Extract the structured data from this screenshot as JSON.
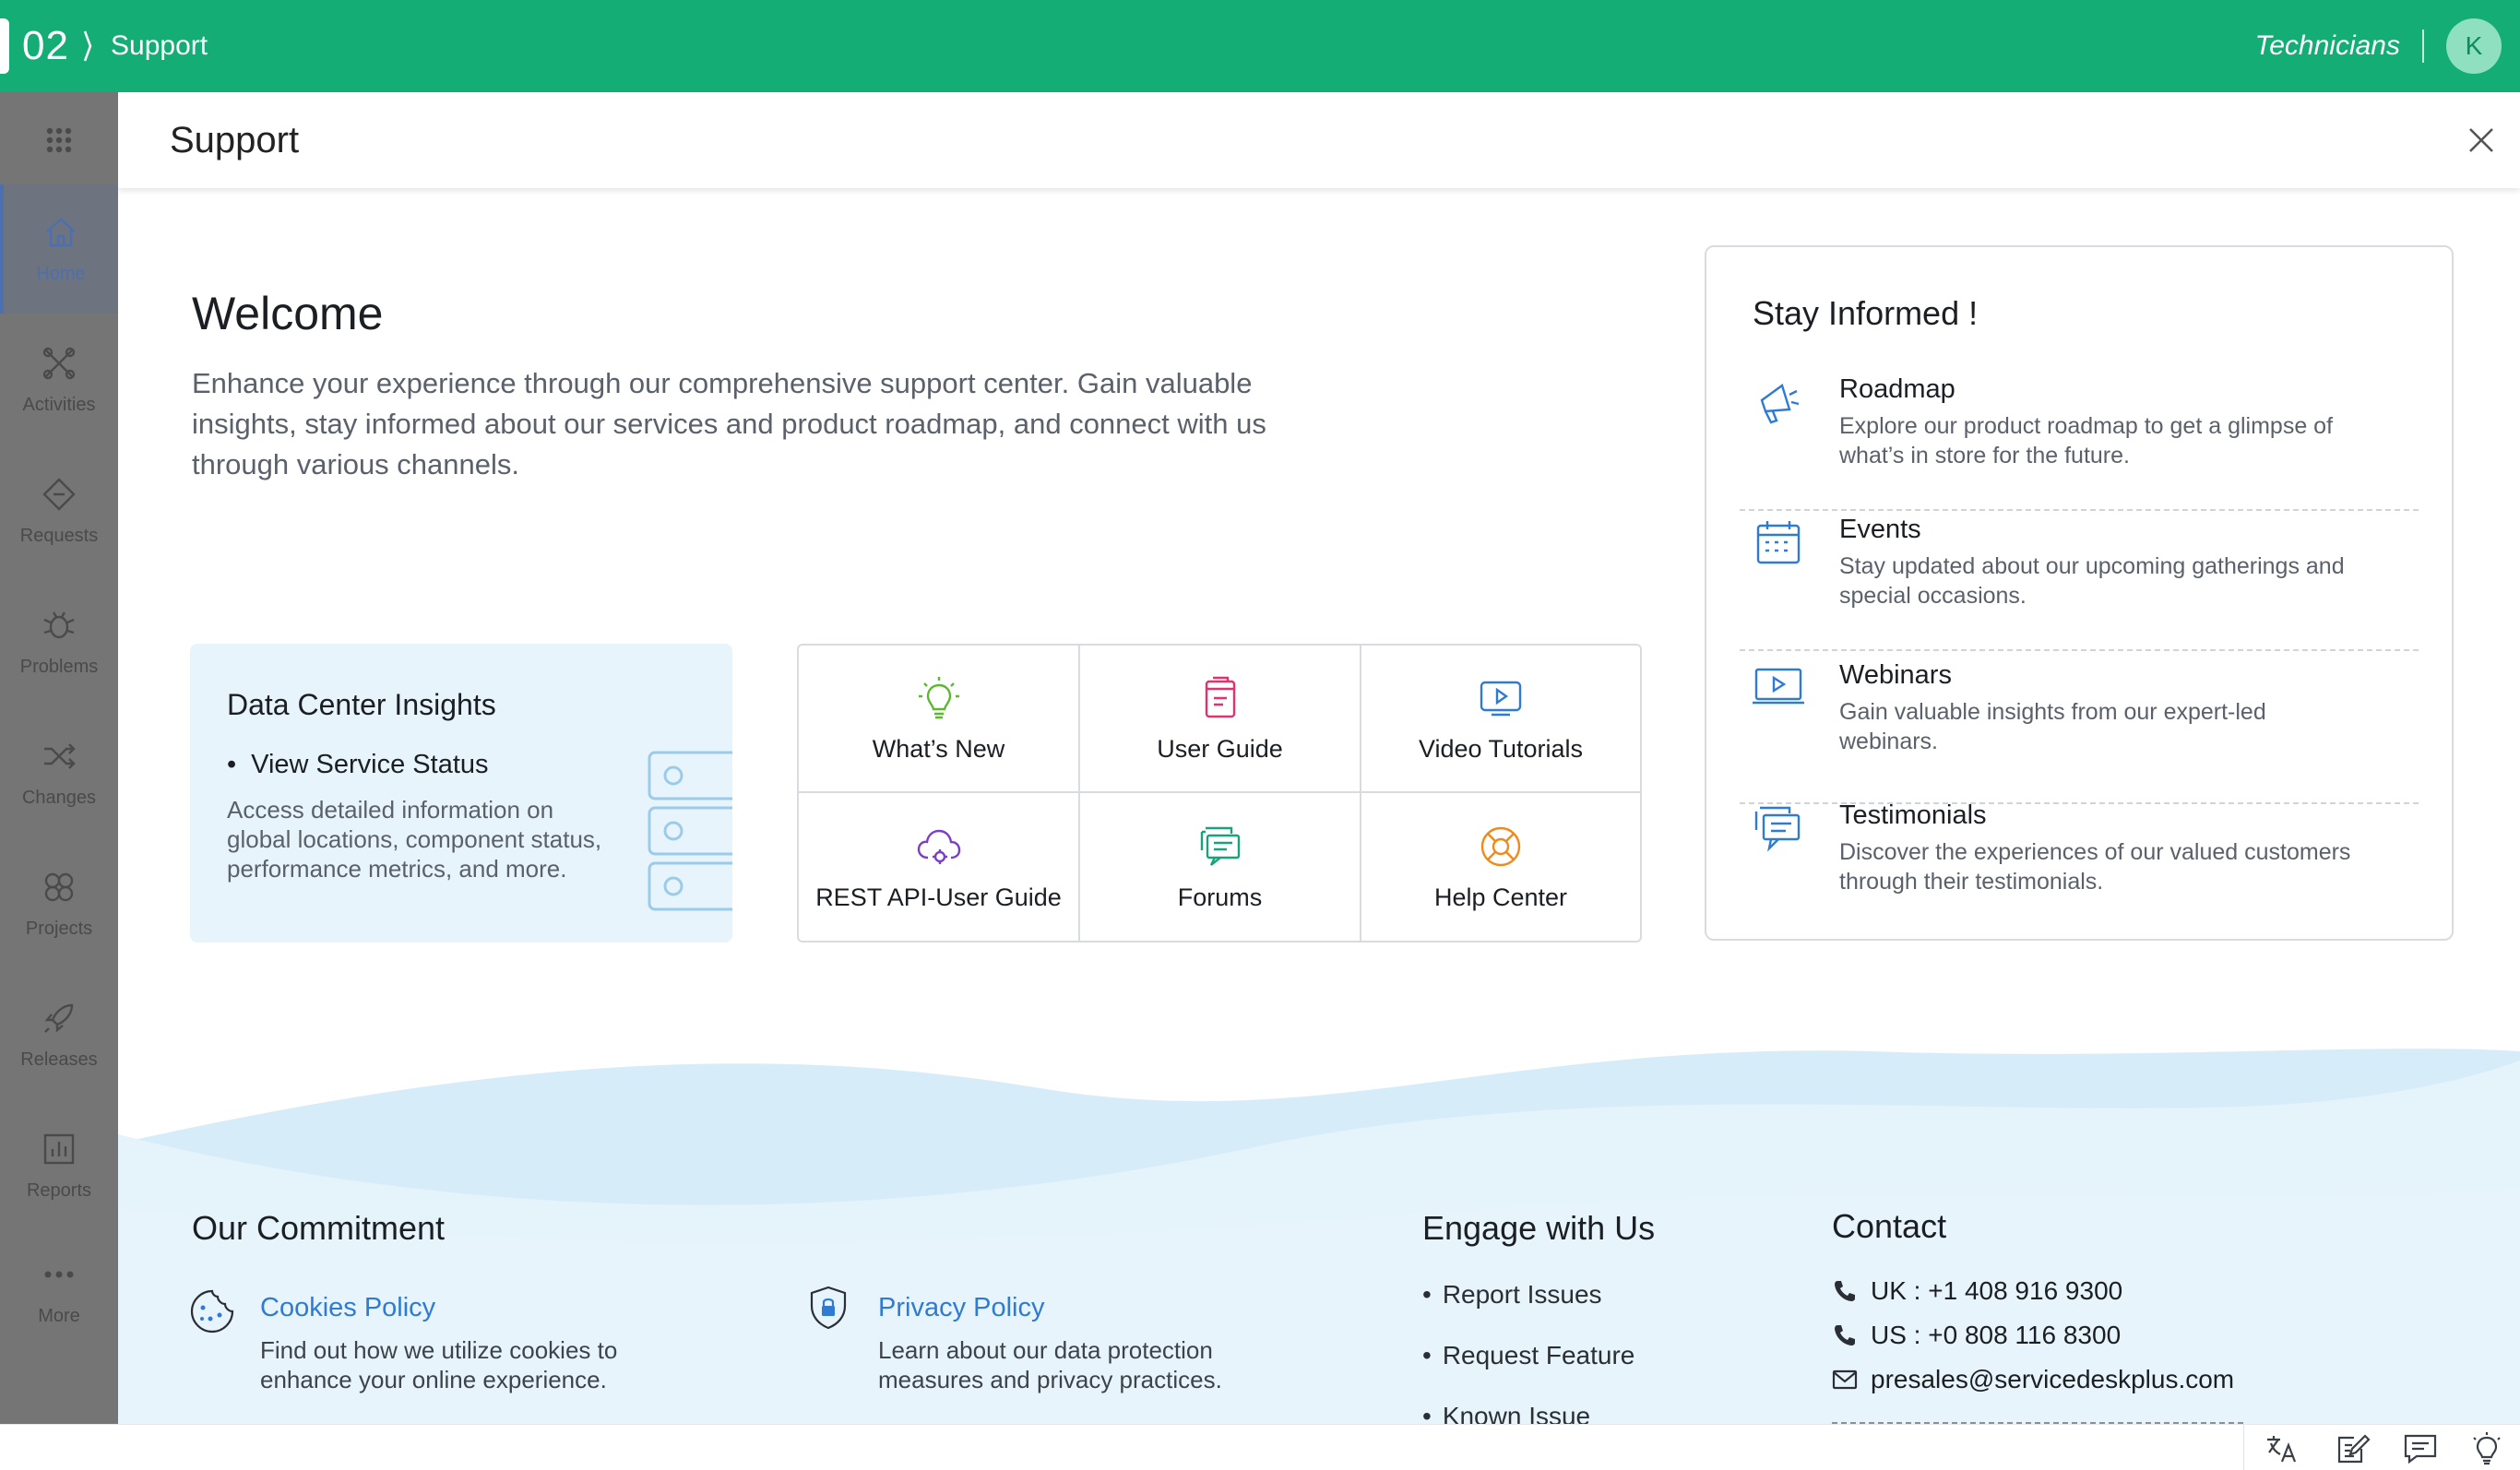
{
  "topbar": {
    "logo_number": "02",
    "app_name": "Support",
    "role": "Technicians",
    "avatar_initial": "K",
    "accent_color": "#14ad76"
  },
  "sidebar": {
    "items": [
      {
        "label": "Home",
        "icon": "home-icon",
        "active": true
      },
      {
        "label": "Activities",
        "icon": "activities-icon"
      },
      {
        "label": "Requests",
        "icon": "requests-icon"
      },
      {
        "label": "Problems",
        "icon": "problems-icon"
      },
      {
        "label": "Changes",
        "icon": "changes-icon"
      },
      {
        "label": "Projects",
        "icon": "projects-icon"
      },
      {
        "label": "Releases",
        "icon": "releases-icon"
      },
      {
        "label": "Reports",
        "icon": "reports-icon"
      },
      {
        "label": "More",
        "icon": "more-icon"
      }
    ]
  },
  "panel": {
    "title": "Support"
  },
  "welcome": {
    "title": "Welcome",
    "text": "Enhance your experience through our comprehensive support center. Gain valuable insights, stay informed about our services and product roadmap, and connect with us through various channels."
  },
  "data_center": {
    "title": "Data Center Insights",
    "bullet": "View Service Status",
    "description": "Access detailed information on global locations, component status, performance metrics, and more."
  },
  "quick_links": [
    {
      "label": "What’s New",
      "icon": "lightbulb-icon"
    },
    {
      "label": "User Guide",
      "icon": "book-icon"
    },
    {
      "label": "Video Tutorials",
      "icon": "video-icon"
    },
    {
      "label": "REST API-User Guide",
      "icon": "cloud-gear-icon"
    },
    {
      "label": "Forums",
      "icon": "forum-icon"
    },
    {
      "label": "Help Center",
      "icon": "lifebuoy-icon"
    }
  ],
  "stay_informed": {
    "title": "Stay Informed !",
    "items": [
      {
        "title": "Roadmap",
        "description": "Explore our product roadmap to get a glimpse of what’s in store for the future.",
        "icon": "megaphone-icon"
      },
      {
        "title": "Events",
        "description": "Stay updated about our upcoming gatherings and special occasions.",
        "icon": "calendar-icon"
      },
      {
        "title": "Webinars",
        "description": "Gain valuable insights from our expert-led webinars.",
        "icon": "webinar-icon"
      },
      {
        "title": "Testimonials",
        "description": "Discover the experiences of our valued customers through their testimonials.",
        "icon": "testimonial-icon"
      }
    ]
  },
  "commitment": {
    "title": "Our Commitment",
    "cookies": {
      "title": "Cookies Policy",
      "description": "Find out how we utilize cookies to enhance your online experience."
    },
    "privacy": {
      "title": "Privacy Policy",
      "description": "Learn about our data protection measures and privacy practices."
    }
  },
  "engage": {
    "title": "Engage with Us",
    "items": [
      "Report Issues",
      "Request Feature",
      "Known Issue"
    ]
  },
  "contact": {
    "title": "Contact",
    "uk": "UK : +1 408 916 9300",
    "us": "US : +0 808 116 8300",
    "email": "presales@servicedeskplus.com"
  }
}
